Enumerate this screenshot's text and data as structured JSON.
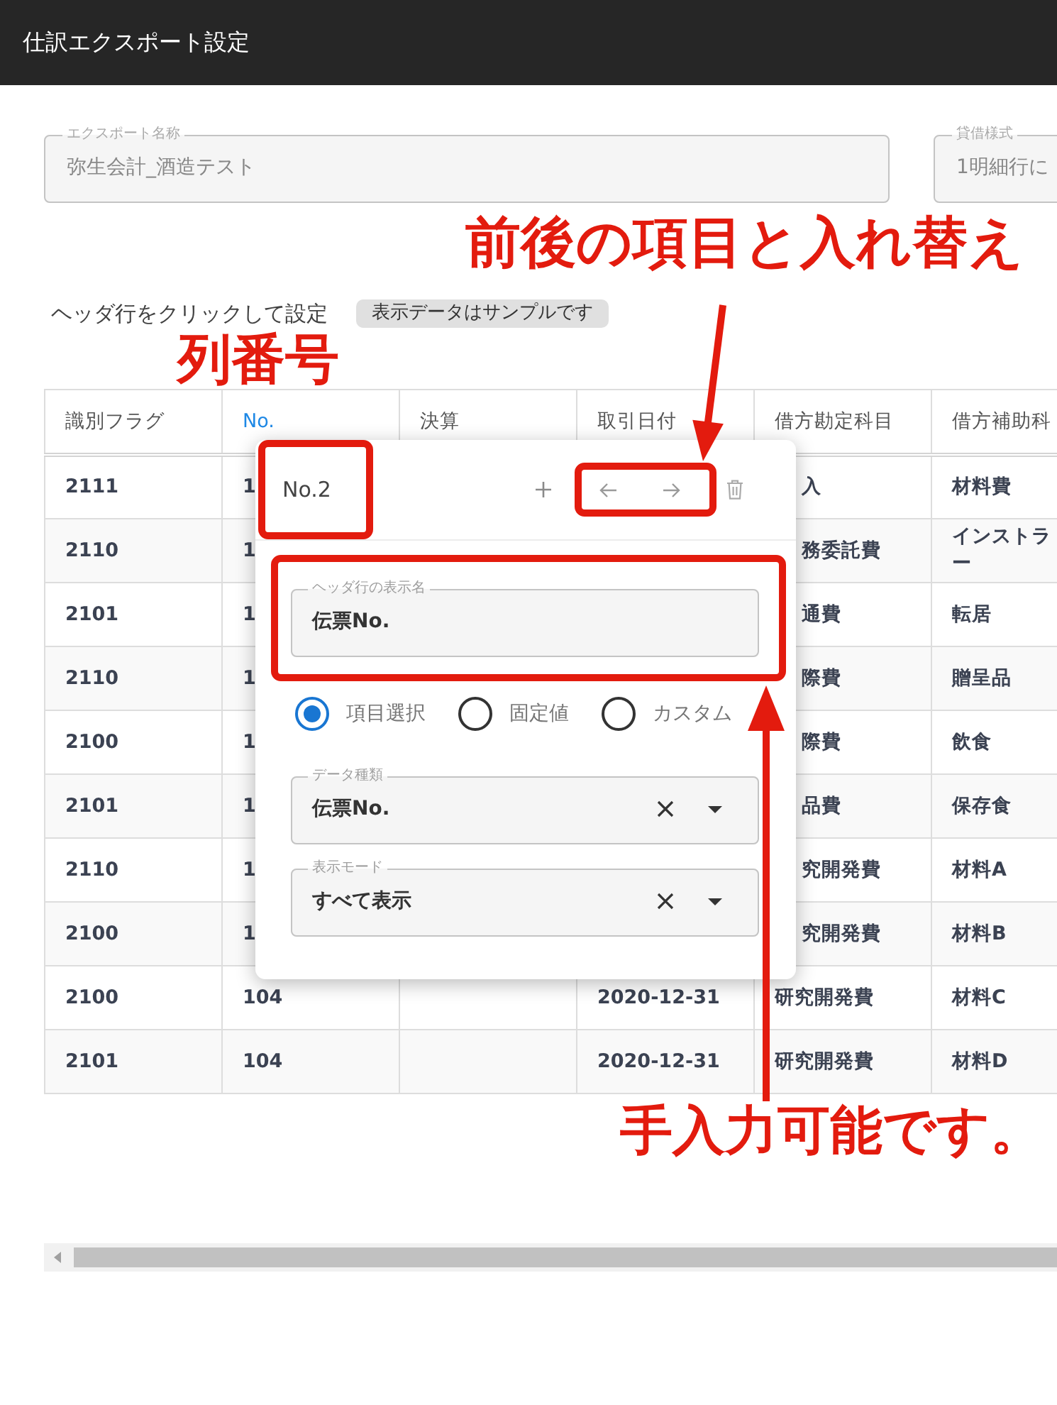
{
  "app_bar": {
    "title": "仕訳エクスポート設定"
  },
  "settings": [
    {
      "label": "エクスポート名称",
      "value": "弥生会計_酒造テスト",
      "disabled": true
    },
    {
      "label": "貸借様式",
      "value": "1明細行に",
      "disabled": true
    }
  ],
  "hint": {
    "text": "ヘッダ行をクリックして設定",
    "badge": "表示データはサンプルです"
  },
  "table": {
    "columns": [
      {
        "label": "識別フラグ",
        "selected": false
      },
      {
        "label": "No.",
        "selected": true
      },
      {
        "label": "決算",
        "selected": false
      },
      {
        "label": "取引日付",
        "selected": false
      },
      {
        "label": "借方勘定科目",
        "selected": false
      },
      {
        "label": "借方補助科",
        "selected": false
      }
    ],
    "rows": [
      {
        "flag": "2111",
        "no": "1",
        "debit_account": "入",
        "debit_sub": "材料費"
      },
      {
        "flag": "2110",
        "no": "1",
        "debit_account": "務委託費",
        "debit_sub": "インストラー"
      },
      {
        "flag": "2101",
        "no": "1",
        "debit_account": "通費",
        "debit_sub": "転居"
      },
      {
        "flag": "2110",
        "no": "1",
        "debit_account": "際費",
        "debit_sub": "贈呈品"
      },
      {
        "flag": "2100",
        "no": "1",
        "debit_account": "際費",
        "debit_sub": "飲食"
      },
      {
        "flag": "2101",
        "no": "1",
        "debit_account": "品費",
        "debit_sub": "保存食"
      },
      {
        "flag": "2110",
        "no": "1",
        "debit_account": "究開発費",
        "debit_sub": "材料A"
      },
      {
        "flag": "2100",
        "no": "1",
        "debit_account": "究開発費",
        "debit_sub": "材料B"
      },
      {
        "flag": "2100",
        "no": "104",
        "date": "2020-12-31",
        "debit_account": "研究開発費",
        "debit_sub": "材料C"
      },
      {
        "flag": "2101",
        "no": "104",
        "date": "2020-12-31",
        "debit_account": "研究開発費",
        "debit_sub": "材料D"
      }
    ]
  },
  "column_editor": {
    "column_number": "No.2",
    "display_name": {
      "label": "ヘッダ行の表示名",
      "value": "伝票No."
    },
    "modes": [
      {
        "label": "項目選択",
        "selected": true
      },
      {
        "label": "固定値",
        "selected": false
      },
      {
        "label": "カスタム",
        "selected": false
      }
    ],
    "selects": [
      {
        "label": "データ種類",
        "value": "伝票No."
      },
      {
        "label": "表示モード",
        "value": "すべて表示"
      }
    ]
  },
  "annotations": {
    "swap": "前後の項目と入れ替え",
    "column_number": "列番号",
    "manual_input": "手入力可能です。"
  }
}
